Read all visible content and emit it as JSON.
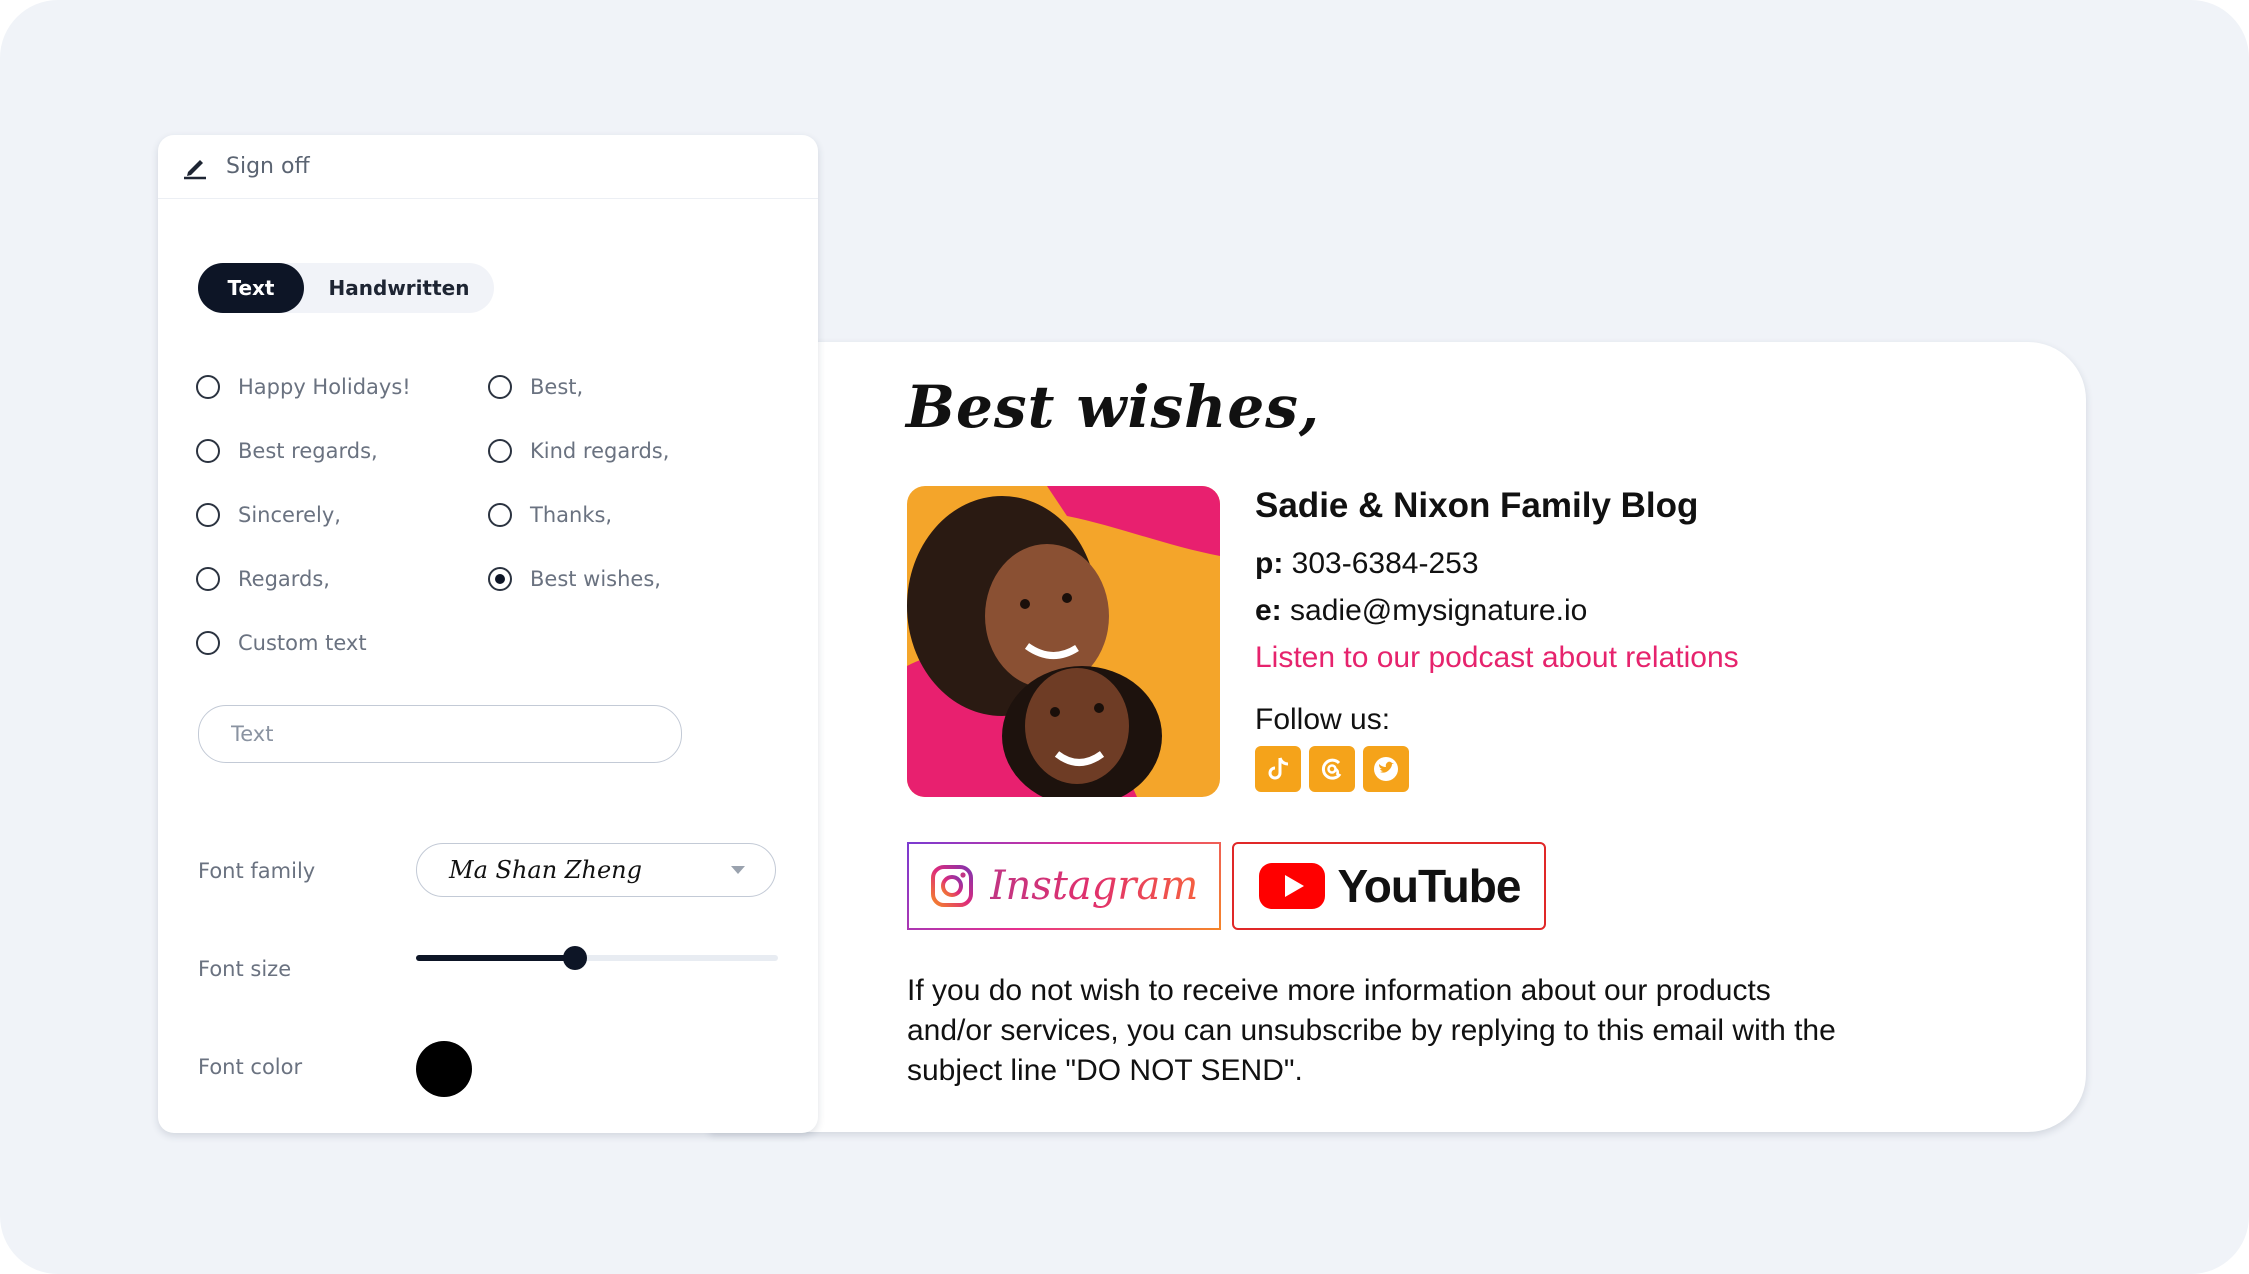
{
  "panel": {
    "header_title": "Sign off",
    "header_icon": "pen-icon",
    "tabs": [
      {
        "label": "Text",
        "active": true
      },
      {
        "label": "Handwritten",
        "active": false
      }
    ],
    "signoff_options": [
      {
        "label": "Happy Holidays!",
        "selected": false
      },
      {
        "label": "Best,",
        "selected": false
      },
      {
        "label": "Best regards,",
        "selected": false
      },
      {
        "label": "Kind regards,",
        "selected": false
      },
      {
        "label": "Sincerely,",
        "selected": false
      },
      {
        "label": "Thanks,",
        "selected": false
      },
      {
        "label": "Regards,",
        "selected": false
      },
      {
        "label": "Best wishes,",
        "selected": true
      },
      {
        "label": "Custom text",
        "selected": false
      }
    ],
    "custom_text": {
      "value": "",
      "placeholder": "Text"
    },
    "font_family": {
      "label": "Font family",
      "value": "Ma Shan Zheng"
    },
    "font_size": {
      "label": "Font size",
      "value_fraction": 0.44
    },
    "font_color": {
      "label": "Font color",
      "value": "#000000"
    }
  },
  "signature": {
    "signoff_text": "Best wishes,",
    "company": "Sadie & Nixon Family Blog",
    "phone_label": "p:",
    "phone": "303-6384-253",
    "email_label": "e:",
    "email": "sadie@mysignature.io",
    "podcast_link": "Listen to our podcast about relations",
    "follow_label": "Follow us:",
    "social_icons": [
      "tiktok-icon",
      "threads-icon",
      "twitter-icon"
    ],
    "social_color": "#f5a31a",
    "link_color": "#e6236d",
    "buttons": [
      {
        "label": "Instagram",
        "icon": "instagram-icon"
      },
      {
        "label": "YouTube",
        "icon": "youtube-icon"
      }
    ],
    "disclaimer": "If you do not wish to receive more information about our products and/or services, you can unsubscribe by replying to this email with the subject line \"DO NOT SEND\"."
  }
}
